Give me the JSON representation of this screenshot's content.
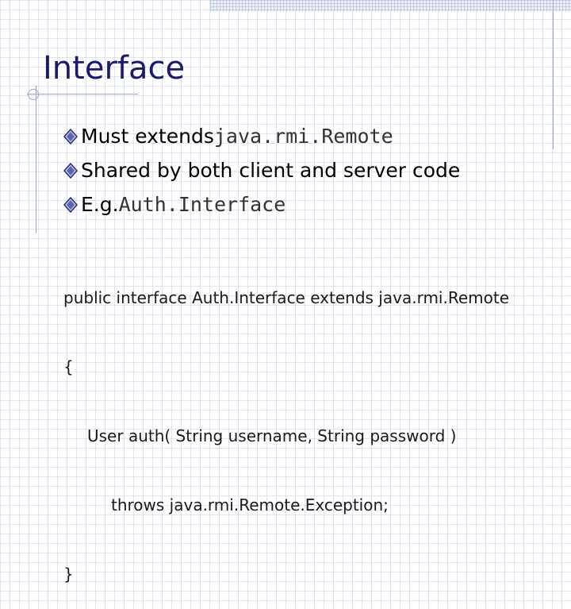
{
  "slide": {
    "title": "Interface",
    "bullets": [
      {
        "text": "Must extends ",
        "code": "java.rmi.Remote",
        "icon": "diamond-bullet-icon"
      },
      {
        "text": "Shared by both client and server code",
        "code": "",
        "icon": "diamond-bullet-icon"
      },
      {
        "text": "E.g. ",
        "code": "Auth.Interface",
        "icon": "diamond-bullet-icon"
      }
    ],
    "code_lines": [
      "public interface Auth.Interface extends java.rmi.Remote",
      "{",
      "User auth( String username, String password )",
      "throws java.rmi.Remote.Exception;",
      "}"
    ]
  },
  "colors": {
    "title": "#1a1a6e",
    "accent_lines": "#98a6d0",
    "grid": "#c8d0e8"
  }
}
